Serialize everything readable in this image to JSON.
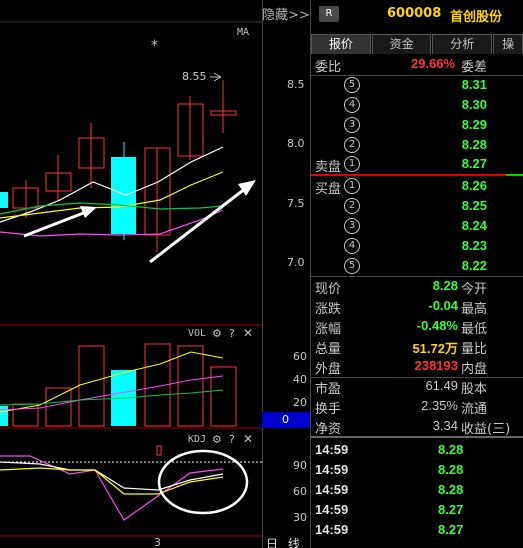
{
  "chart": {
    "hide_label": "隐藏>>",
    "ma_label": "MA",
    "high_marker": "8.55",
    "price_ticks": [
      "8.5",
      "8.0",
      "7.5",
      "7.0"
    ],
    "vol_label": "VOL",
    "vol_ticks": [
      "60",
      "40",
      "20"
    ],
    "vol_zero": "0",
    "kdj_label": "KDJ",
    "kdj_ticks": [
      "90",
      "60",
      "30"
    ],
    "bottom_number": "3",
    "period_label": "日 线"
  },
  "panel": {
    "badge": "R",
    "code": "600008",
    "name": "首创股份",
    "tabs": [
      "报价",
      "资金",
      "分析",
      "操"
    ],
    "active_tab": 0,
    "ratio_label": "委比",
    "ratio_value": "29.66%",
    "diff_label": "委差",
    "sell": [
      {
        "label": "",
        "num": "5",
        "price": "8.31"
      },
      {
        "label": "",
        "num": "4",
        "price": "8.30"
      },
      {
        "label": "",
        "num": "3",
        "price": "8.29"
      },
      {
        "label": "",
        "num": "2",
        "price": "8.28"
      },
      {
        "label": "卖盘",
        "num": "1",
        "price": "8.27"
      }
    ],
    "buy": [
      {
        "label": "买盘",
        "num": "1",
        "price": "8.26"
      },
      {
        "label": "",
        "num": "2",
        "price": "8.25"
      },
      {
        "label": "",
        "num": "3",
        "price": "8.24"
      },
      {
        "label": "",
        "num": "4",
        "price": "8.23"
      },
      {
        "label": "",
        "num": "5",
        "price": "8.22"
      }
    ],
    "stats": [
      {
        "label": "现价",
        "value": "8.28",
        "color": "#33ff33",
        "label2": "今开"
      },
      {
        "label": "涨跌",
        "value": "-0.04",
        "color": "#33ff33",
        "label2": "最高"
      },
      {
        "label": "涨幅",
        "value": "-0.48%",
        "color": "#33ff33",
        "label2": "最低"
      },
      {
        "label": "总量",
        "value": "51.72万",
        "color": "#ffd400",
        "label2": "量比"
      },
      {
        "label": "外盘",
        "value": "238193",
        "color": "#ff3333",
        "label2": "内盘"
      },
      {
        "label": "市盈",
        "value": "61.49",
        "color": "#c8c8c8",
        "label2": "股本"
      },
      {
        "label": "换手",
        "value": "2.35%",
        "color": "#c8c8c8",
        "label2": "流通"
      },
      {
        "label": "净资",
        "value": "3.34",
        "color": "#c8c8c8",
        "label2": "收益(三)"
      }
    ],
    "ticks": [
      {
        "time": "14:59",
        "price": "8.28"
      },
      {
        "time": "14:59",
        "price": "8.28"
      },
      {
        "time": "14:59",
        "price": "8.28"
      },
      {
        "time": "14:59",
        "price": "8.27"
      },
      {
        "time": "14:59",
        "price": "8.27"
      }
    ]
  },
  "colors": {
    "up_candle": "#ff3333",
    "down_candle": "#00ffff",
    "ma_white": "#ffffff",
    "ma_yellow": "#ffff00",
    "ma_green": "#00cc44",
    "ma_magenta": "#ff44ff",
    "arrow": "#ffffff"
  }
}
